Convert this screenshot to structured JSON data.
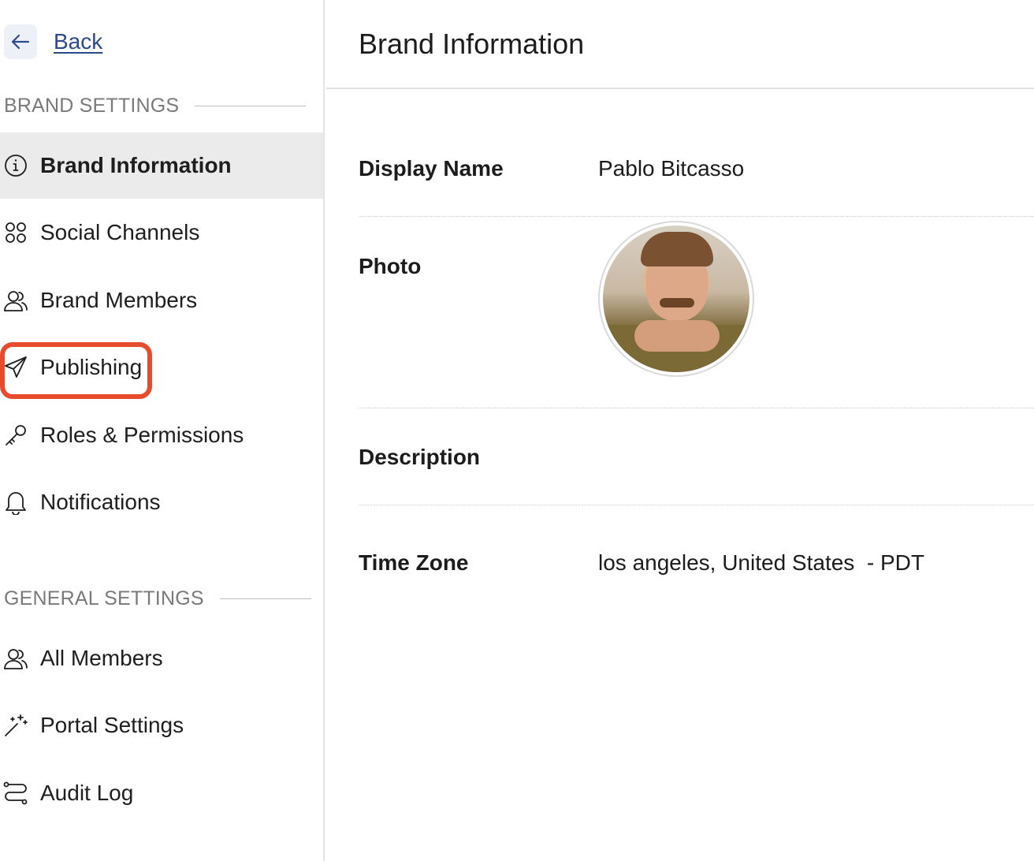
{
  "sidebar": {
    "back_label": "Back",
    "brand_settings_title": "BRAND SETTINGS",
    "general_settings_title": "GENERAL SETTINGS",
    "brand_items": [
      {
        "label": "Brand Information",
        "icon": "info-icon",
        "active": true
      },
      {
        "label": "Social Channels",
        "icon": "social-channels-icon",
        "active": false
      },
      {
        "label": "Brand Members",
        "icon": "users-icon",
        "active": false
      },
      {
        "label": "Publishing",
        "icon": "paper-plane-icon",
        "active": false
      },
      {
        "label": "Roles & Permissions",
        "icon": "key-icon",
        "active": false
      },
      {
        "label": "Notifications",
        "icon": "bell-icon",
        "active": false
      }
    ],
    "general_items": [
      {
        "label": "All Members",
        "icon": "users-icon"
      },
      {
        "label": "Portal Settings",
        "icon": "magic-wand-icon"
      },
      {
        "label": "Audit Log",
        "icon": "route-icon"
      }
    ]
  },
  "main": {
    "title": "Brand Information",
    "fields": {
      "display_name_label": "Display Name",
      "display_name_value": "Pablo Bitcasso",
      "photo_label": "Photo",
      "description_label": "Description",
      "description_value": "",
      "time_zone_label": "Time Zone",
      "time_zone_value": "los angeles, United States  - PDT"
    }
  },
  "colors": {
    "accent_link": "#2c4a8c",
    "highlight": "#e84a2e",
    "active_bg": "#ebebeb"
  }
}
